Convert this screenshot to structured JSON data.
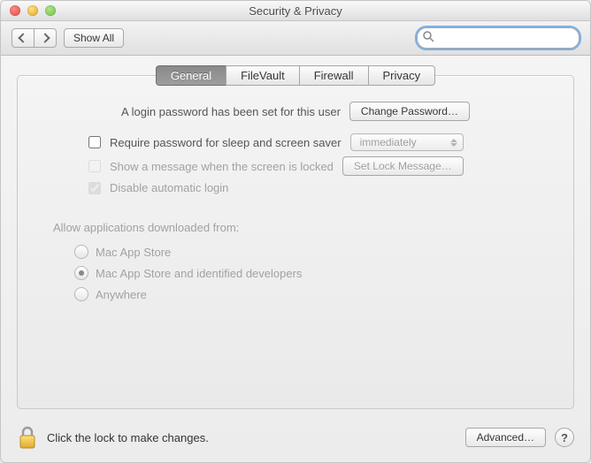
{
  "window": {
    "title": "Security & Privacy"
  },
  "toolbar": {
    "show_all": "Show All",
    "search_placeholder": ""
  },
  "tabs": [
    "General",
    "FileVault",
    "Firewall",
    "Privacy"
  ],
  "active_tab": 0,
  "general": {
    "login_pw_set": "A login password has been set for this user",
    "change_password": "Change Password…",
    "require_pw_label": "Require password for sleep and screen saver",
    "require_pw_delay": "immediately",
    "show_msg_label": "Show a message when the screen is locked",
    "set_lock_msg": "Set Lock Message…",
    "disable_auto_login": "Disable automatic login",
    "gatekeeper_heading": "Allow applications downloaded from:",
    "gatekeeper_options": [
      "Mac App Store",
      "Mac App Store and identified developers",
      "Anywhere"
    ],
    "gatekeeper_selected": 1
  },
  "footer": {
    "lock_msg": "Click the lock to make changes.",
    "advanced": "Advanced…"
  }
}
